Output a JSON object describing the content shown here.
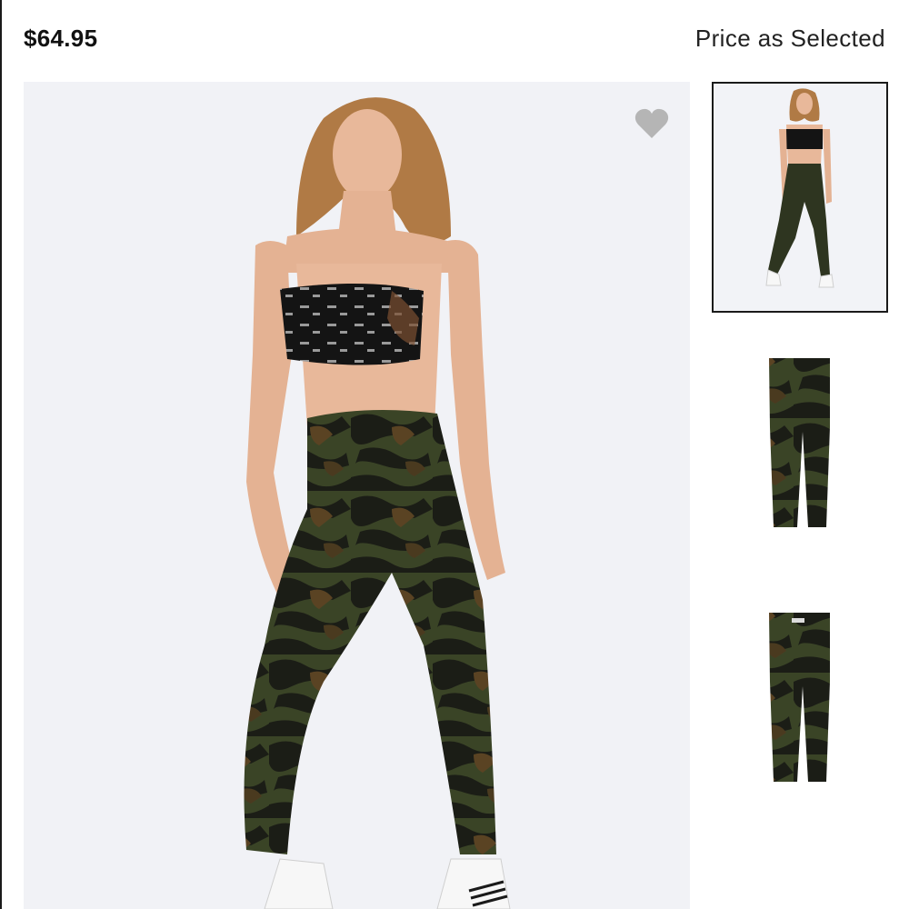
{
  "product": {
    "price": "$64.95",
    "price_note": "Price as Selected"
  },
  "gallery": {
    "favorite_icon": "heart-icon",
    "thumbnails": [
      {
        "label": "model-full-outfit",
        "selected": true
      },
      {
        "label": "legging-front",
        "selected": false
      },
      {
        "label": "legging-back",
        "selected": false
      }
    ]
  },
  "colors": {
    "camo_dark": "#1b1d16",
    "camo_olive": "#3a4426",
    "camo_brown": "#5a4323",
    "background": "#f1f2f6"
  }
}
